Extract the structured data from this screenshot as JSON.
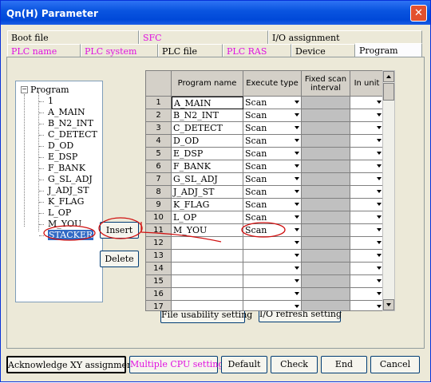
{
  "window": {
    "title": "Qn(H) Parameter"
  },
  "tabs_row1": [
    "Boot file",
    "SFC",
    "I/O assignment"
  ],
  "tabs_row2": [
    "PLC name",
    "PLC system",
    "PLC file",
    "PLC RAS",
    "Device",
    "Program"
  ],
  "tree": {
    "root": "Program",
    "items": [
      "1",
      "A_MAIN",
      "B_N2_INT",
      "C_DETECT",
      "D_OD",
      "E_DSP",
      "F_BANK",
      "G_SL_ADJ",
      "J_ADJ_ST",
      "K_FLAG",
      "L_OP",
      "M_YOU",
      "STACKER"
    ],
    "selected": "STACKER"
  },
  "buttons": {
    "insert": "Insert",
    "delete": "Delete",
    "file_usability": "File usability setting",
    "io_refresh": "I/O refresh setting",
    "ack_xy": "Acknowledge XY assignment",
    "multi_cpu": "Multiple CPU settings",
    "default": "Default",
    "check": "Check",
    "end": "End",
    "cancel": "Cancel"
  },
  "table": {
    "headers": {
      "program_name": "Program name",
      "execute_type": "Execute type",
      "fixed_scan": "Fixed scan interval",
      "in_unit": "In unit"
    },
    "rows": [
      {
        "no": "1",
        "name": "A_MAIN",
        "type": "Scan"
      },
      {
        "no": "2",
        "name": "B_N2_INT",
        "type": "Scan"
      },
      {
        "no": "3",
        "name": "C_DETECT",
        "type": "Scan"
      },
      {
        "no": "4",
        "name": "D_OD",
        "type": "Scan"
      },
      {
        "no": "5",
        "name": "E_DSP",
        "type": "Scan"
      },
      {
        "no": "6",
        "name": "F_BANK",
        "type": "Scan"
      },
      {
        "no": "7",
        "name": "G_SL_ADJ",
        "type": "Scan"
      },
      {
        "no": "8",
        "name": "J_ADJ_ST",
        "type": "Scan"
      },
      {
        "no": "9",
        "name": "K_FLAG",
        "type": "Scan"
      },
      {
        "no": "10",
        "name": "L_OP",
        "type": "Scan"
      },
      {
        "no": "11",
        "name": "M_YOU",
        "type": "Scan"
      },
      {
        "no": "12",
        "name": "",
        "type": ""
      },
      {
        "no": "13",
        "name": "",
        "type": ""
      },
      {
        "no": "14",
        "name": "",
        "type": ""
      },
      {
        "no": "15",
        "name": "",
        "type": ""
      },
      {
        "no": "16",
        "name": "",
        "type": ""
      },
      {
        "no": "17",
        "name": "",
        "type": ""
      }
    ]
  },
  "colors": {
    "title_bar": "#0a55e0",
    "annotation": "#d01010",
    "selection": "#316ac5",
    "accent_text": "#e010e0"
  }
}
